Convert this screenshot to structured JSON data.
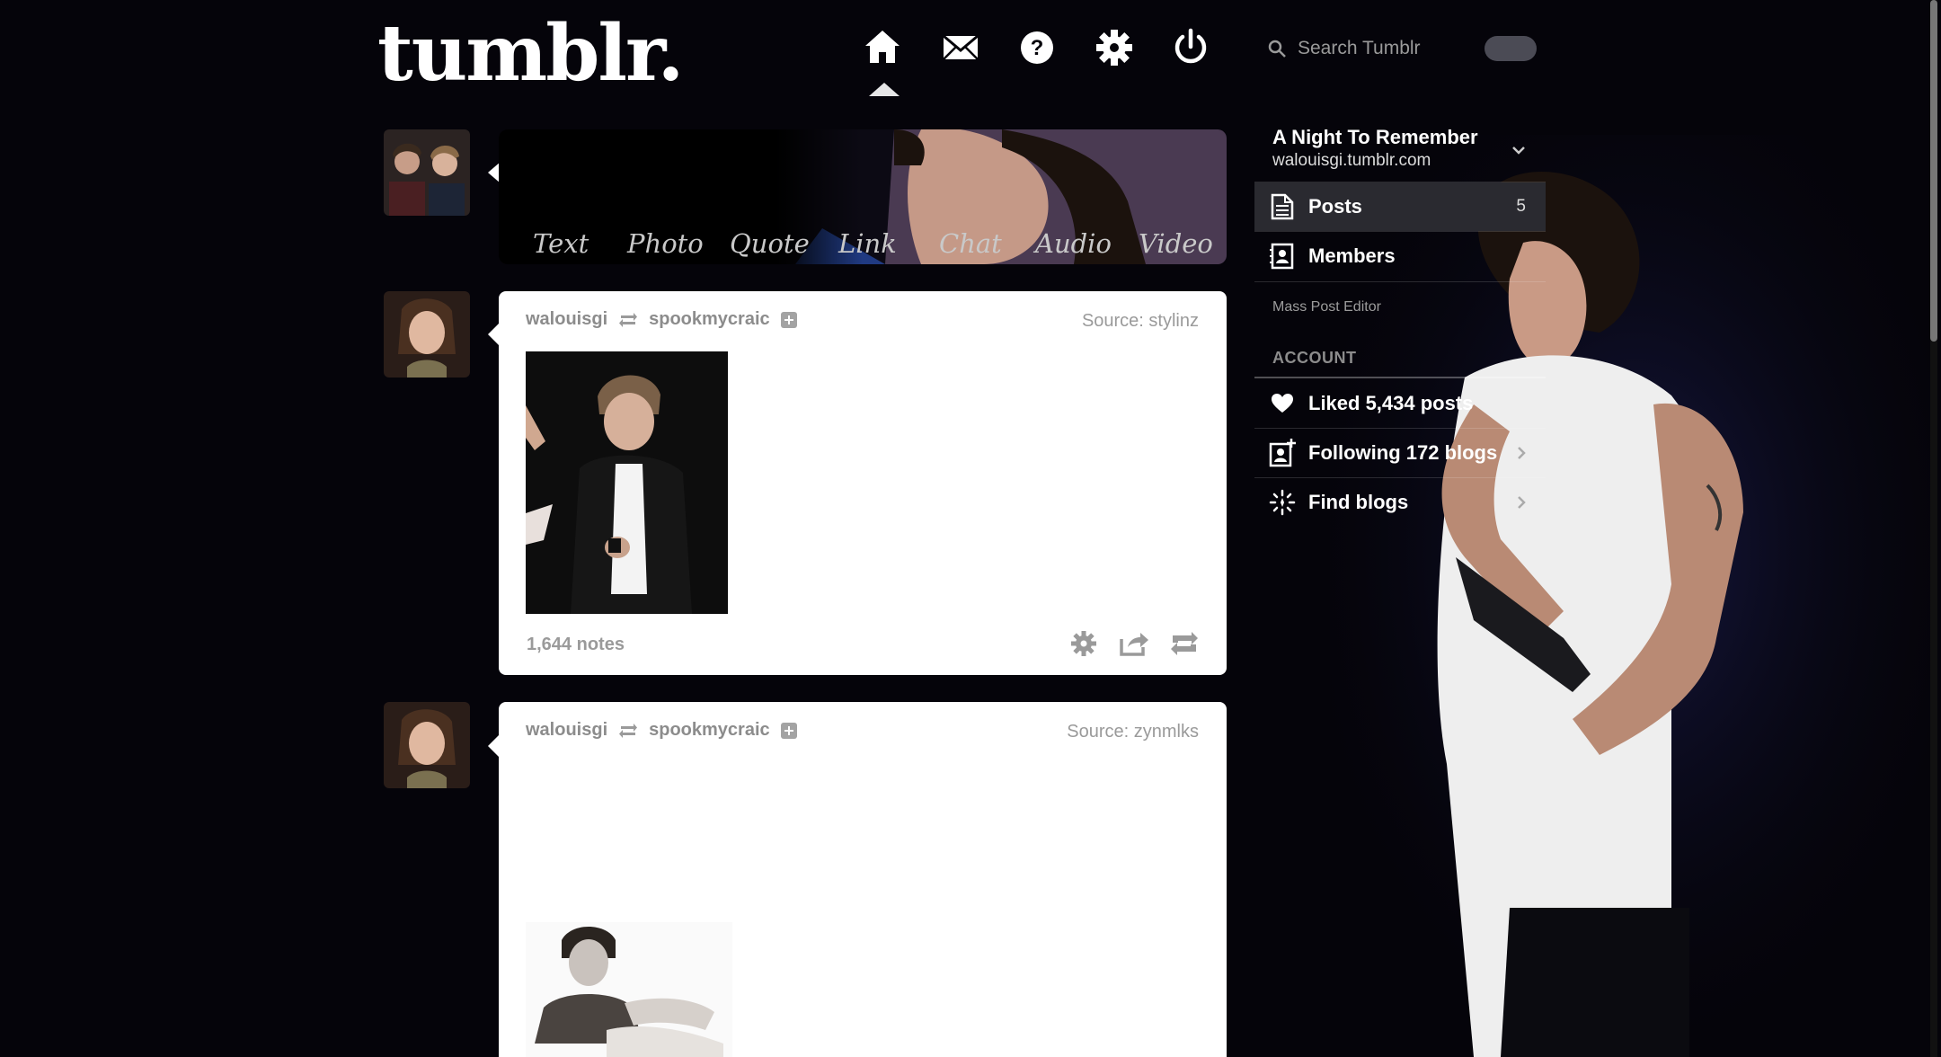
{
  "header": {
    "logo": "tumblr.",
    "nav": [
      "home-icon",
      "messages-icon",
      "help-icon",
      "settings-icon",
      "logout-icon"
    ],
    "search_placeholder": "Search Tumblr"
  },
  "post_types": [
    "Text",
    "Photo",
    "Quote",
    "Link",
    "Chat",
    "Audio",
    "Video"
  ],
  "posts": [
    {
      "author": "walouisgi",
      "reblogged_from": "spookmycraic",
      "source": "Source: stylinz",
      "notes": "1,644 notes"
    },
    {
      "author": "walouisgi",
      "reblogged_from": "spookmycraic",
      "source": "Source: zynmlks"
    }
  ],
  "sidebar": {
    "blog_title": "A Night To Remember",
    "blog_url": "walouisgi.tumblr.com",
    "posts_label": "Posts",
    "posts_count": "5",
    "members_label": "Members",
    "mass_post_editor": "Mass Post Editor",
    "account_header": "ACCOUNT",
    "liked": "Liked 5,434 posts",
    "following": "Following 172 blogs",
    "find_blogs": "Find blogs"
  },
  "colors": {
    "background": "#05040a",
    "post_bg": "#ffffff",
    "active_row": "#2a2a30"
  }
}
